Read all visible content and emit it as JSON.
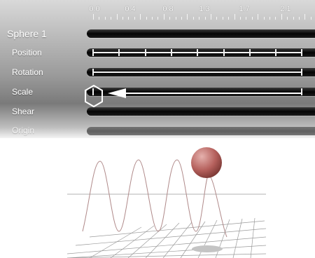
{
  "ruler": {
    "labels": [
      "0.0",
      "0.4",
      "0.8",
      "1.3",
      "1.7",
      "2.1"
    ]
  },
  "tracks": {
    "object_label": "Sphere 1",
    "props": [
      "Position",
      "Rotation",
      "Scale",
      "Shear",
      "Origin"
    ]
  },
  "colors": {
    "track": "#0a0a0a",
    "accent": "#ffffff",
    "sphere": "#b5605c"
  }
}
